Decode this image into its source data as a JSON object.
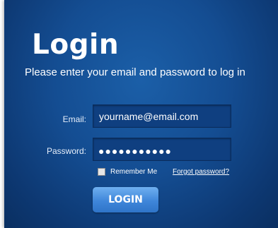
{
  "login": {
    "title": "Login",
    "subtitle": "Please enter your email and password to log in",
    "email_label": "Email:",
    "email_value": "yourname@email.com",
    "password_label": "Password:",
    "password_mask": "●●●●●●●●●●●",
    "remember_label": "Remember Me",
    "remember_checked": false,
    "forgot_label": "Forgot password?",
    "login_button": "LOGIN"
  },
  "colors": {
    "panel_bg": "#144d92",
    "field_bg": "#0f3f80",
    "button_bg": "#3f86da",
    "text": "#ffffff"
  }
}
